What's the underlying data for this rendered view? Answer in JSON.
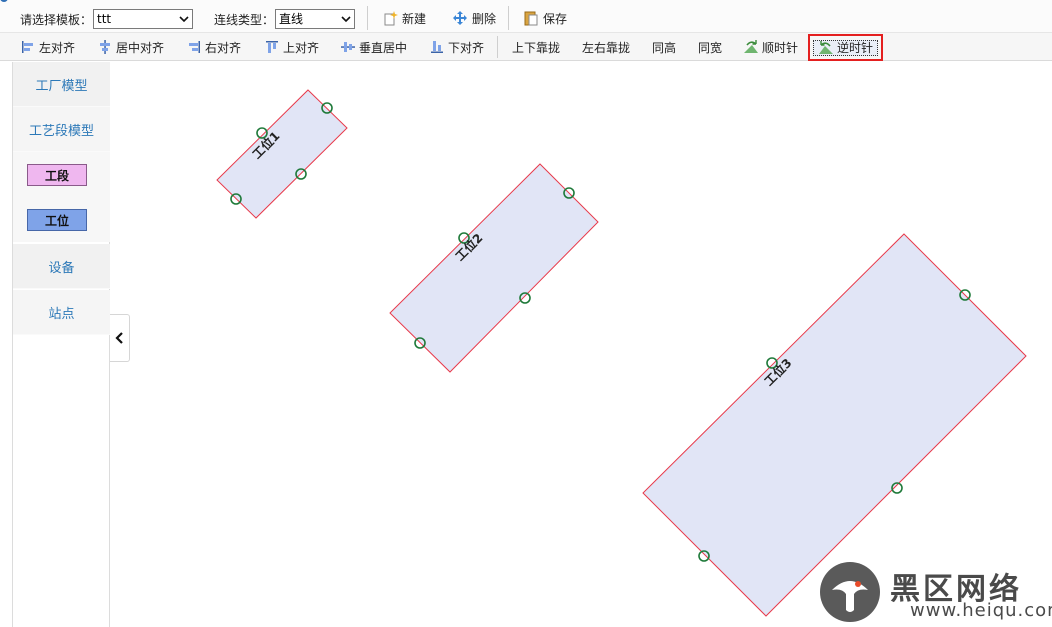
{
  "toolbar_top": {
    "template_label": "请选择模板：",
    "template_value": "ttt",
    "link_type_label": "连线类型：",
    "link_type_value": "直线",
    "new_label": "新建",
    "delete_label": "删除",
    "save_label": "保存"
  },
  "toolbar_align": {
    "left_align": "左对齐",
    "center_align": "居中对齐",
    "right_align": "右对齐",
    "top_align": "上对齐",
    "vertical_center": "垂直居中",
    "bottom_align": "下对齐",
    "vertical_snap": "上下靠拢",
    "horizontal_snap": "左右靠拢",
    "same_height": "同高",
    "same_width": "同宽",
    "clockwise": "顺时针",
    "counterclockwise": "逆时针"
  },
  "sidebar": {
    "factory_model": "工厂模型",
    "process_segment_model": "工艺段模型",
    "segment_chip": "工段",
    "station_chip": "工位",
    "equipment": "设备",
    "site": "站点"
  },
  "canvas": {
    "nodes": [
      {
        "label": "工位1"
      },
      {
        "label": "工位2"
      },
      {
        "label": "工位3"
      }
    ]
  },
  "colors": {
    "node_fill": "#e1e5f6",
    "node_border": "#e8394a",
    "port_stroke": "#1f7a3a",
    "segment_chip": "#efb7ef",
    "station_chip": "#7fa3e8",
    "sidebar_text": "#2d79b8",
    "highlight": "#e41f1f"
  },
  "watermark": {
    "title": "黑区网络",
    "url": "www.heiqu.com"
  }
}
